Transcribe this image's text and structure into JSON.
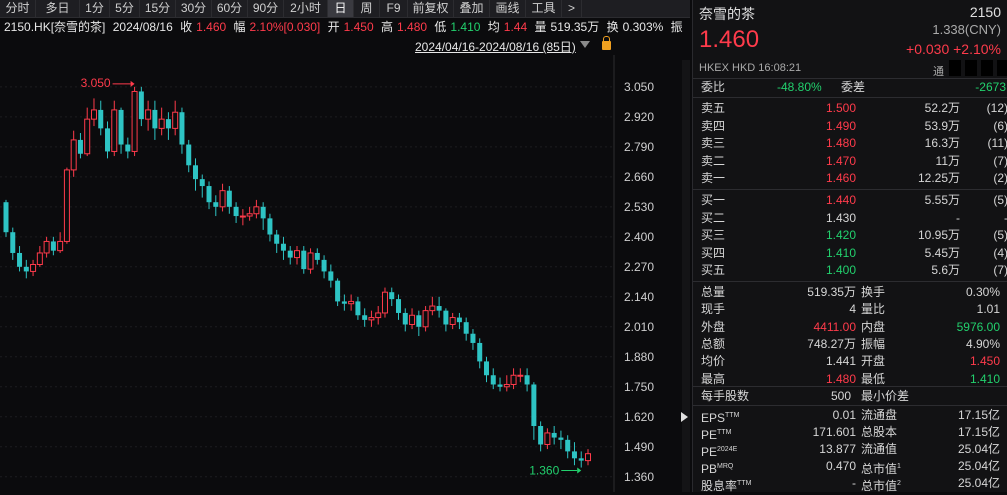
{
  "toolbar": {
    "items": [
      "分时",
      "多日",
      "1分",
      "5分",
      "15分",
      "30分",
      "60分",
      "90分",
      "2小时",
      "日",
      "周",
      "F9",
      "前复权",
      "叠加",
      "画线",
      "工具",
      ">"
    ],
    "active": "日"
  },
  "info": {
    "code": "2150.HK[奈雪的茶]",
    "date": "2024/08/16",
    "close_label": "收",
    "close": "1.460",
    "amp_label": "幅",
    "amp": "2.10%[0.030]",
    "open_label": "开",
    "open": "1.450",
    "high_label": "高",
    "high": "1.480",
    "low_label": "低",
    "low": "1.410",
    "avg_label": "均",
    "avg": "1.44",
    "vol_label": "量",
    "vol": "519.35万",
    "turn_label": "换",
    "turn": "0.303%",
    "tail": "振"
  },
  "daterange": "2024/04/16-2024/08/16 (85日)",
  "chart_data": {
    "type": "candlestick",
    "ymin": 1.32,
    "ymax": 3.11,
    "yticks": [
      "3.050",
      "2.920",
      "2.790",
      "2.660",
      "2.530",
      "2.400",
      "2.270",
      "2.140",
      "2.010",
      "1.880",
      "1.750",
      "1.620",
      "1.490",
      "1.360"
    ],
    "max_label": "3.050",
    "min_label": "1.360",
    "candles": [
      [
        2.55,
        2.42,
        2.56,
        2.4
      ],
      [
        2.42,
        2.33,
        2.44,
        2.3
      ],
      [
        2.33,
        2.27,
        2.36,
        2.25
      ],
      [
        2.27,
        2.25,
        2.3,
        2.22
      ],
      [
        2.25,
        2.28,
        2.3,
        2.23
      ],
      [
        2.28,
        2.33,
        2.36,
        2.27
      ],
      [
        2.33,
        2.38,
        2.4,
        2.31
      ],
      [
        2.38,
        2.34,
        2.4,
        2.32
      ],
      [
        2.34,
        2.38,
        2.42,
        2.33
      ],
      [
        2.38,
        2.69,
        2.7,
        2.37
      ],
      [
        2.69,
        2.82,
        2.86,
        2.66
      ],
      [
        2.82,
        2.76,
        2.85,
        2.74
      ],
      [
        2.76,
        2.91,
        2.96,
        2.75
      ],
      [
        2.91,
        2.95,
        3.0,
        2.88
      ],
      [
        2.95,
        2.87,
        2.99,
        2.84
      ],
      [
        2.87,
        2.77,
        2.9,
        2.74
      ],
      [
        2.77,
        2.95,
        2.99,
        2.75
      ],
      [
        2.95,
        2.8,
        2.96,
        2.76
      ],
      [
        2.8,
        2.77,
        2.83,
        2.74
      ],
      [
        2.77,
        3.03,
        3.05,
        2.75
      ],
      [
        3.03,
        2.91,
        3.05,
        2.88
      ],
      [
        2.91,
        2.95,
        2.99,
        2.86
      ],
      [
        2.95,
        2.87,
        2.99,
        2.82
      ],
      [
        2.87,
        2.91,
        2.96,
        2.84
      ],
      [
        2.91,
        2.87,
        2.94,
        2.82
      ],
      [
        2.87,
        2.94,
        2.99,
        2.84
      ],
      [
        2.94,
        2.8,
        2.96,
        2.76
      ],
      [
        2.8,
        2.71,
        2.82,
        2.68
      ],
      [
        2.71,
        2.65,
        2.74,
        2.6
      ],
      [
        2.65,
        2.62,
        2.67,
        2.57
      ],
      [
        2.62,
        2.55,
        2.64,
        2.52
      ],
      [
        2.55,
        2.53,
        2.58,
        2.49
      ],
      [
        2.53,
        2.6,
        2.63,
        2.51
      ],
      [
        2.6,
        2.53,
        2.62,
        2.5
      ],
      [
        2.53,
        2.49,
        2.55,
        2.46
      ],
      [
        2.49,
        2.49,
        2.52,
        2.45
      ],
      [
        2.49,
        2.5,
        2.53,
        2.47
      ],
      [
        2.5,
        2.53,
        2.56,
        2.48
      ],
      [
        2.53,
        2.48,
        2.55,
        2.43
      ],
      [
        2.48,
        2.41,
        2.5,
        2.38
      ],
      [
        2.41,
        2.37,
        2.43,
        2.33
      ],
      [
        2.37,
        2.34,
        2.4,
        2.3
      ],
      [
        2.34,
        2.31,
        2.36,
        2.28
      ],
      [
        2.31,
        2.34,
        2.36,
        2.28
      ],
      [
        2.34,
        2.26,
        2.36,
        2.24
      ],
      [
        2.26,
        2.33,
        2.35,
        2.24
      ],
      [
        2.33,
        2.3,
        2.35,
        2.28
      ],
      [
        2.3,
        2.25,
        2.32,
        2.22
      ],
      [
        2.25,
        2.21,
        2.28,
        2.18
      ],
      [
        2.21,
        2.12,
        2.22,
        2.1
      ],
      [
        2.12,
        2.11,
        2.15,
        2.08
      ],
      [
        2.11,
        2.12,
        2.15,
        2.08
      ],
      [
        2.12,
        2.06,
        2.14,
        2.04
      ],
      [
        2.06,
        2.04,
        2.09,
        2.01
      ],
      [
        2.04,
        2.05,
        2.08,
        2.01
      ],
      [
        2.05,
        2.07,
        2.1,
        2.02
      ],
      [
        2.07,
        2.16,
        2.18,
        2.05
      ],
      [
        2.16,
        2.13,
        2.18,
        2.1
      ],
      [
        2.13,
        2.07,
        2.15,
        2.04
      ],
      [
        2.07,
        2.02,
        2.09,
        1.99
      ],
      [
        2.02,
        2.06,
        2.09,
        2.0
      ],
      [
        2.06,
        2.01,
        2.08,
        1.97
      ],
      [
        2.01,
        2.08,
        2.1,
        1.99
      ],
      [
        2.08,
        2.1,
        2.14,
        2.06
      ],
      [
        2.1,
        2.08,
        2.14,
        2.05
      ],
      [
        2.08,
        2.02,
        2.09,
        1.99
      ],
      [
        2.02,
        2.05,
        2.07,
        2.0
      ],
      [
        2.05,
        2.03,
        2.07,
        2.0
      ],
      [
        2.03,
        1.98,
        2.05,
        1.95
      ],
      [
        1.98,
        1.94,
        2.0,
        1.91
      ],
      [
        1.94,
        1.86,
        1.96,
        1.83
      ],
      [
        1.86,
        1.8,
        1.88,
        1.77
      ],
      [
        1.8,
        1.76,
        1.83,
        1.74
      ],
      [
        1.76,
        1.75,
        1.79,
        1.73
      ],
      [
        1.75,
        1.76,
        1.8,
        1.73
      ],
      [
        1.76,
        1.8,
        1.83,
        1.74
      ],
      [
        1.8,
        1.8,
        1.83,
        1.77
      ],
      [
        1.8,
        1.76,
        1.83,
        1.73
      ],
      [
        1.76,
        1.58,
        1.77,
        1.52
      ],
      [
        1.58,
        1.5,
        1.6,
        1.47
      ],
      [
        1.5,
        1.55,
        1.57,
        1.48
      ],
      [
        1.55,
        1.53,
        1.58,
        1.5
      ],
      [
        1.53,
        1.52,
        1.56,
        1.48
      ],
      [
        1.52,
        1.47,
        1.54,
        1.44
      ],
      [
        1.47,
        1.44,
        1.51,
        1.41
      ],
      [
        1.44,
        1.43,
        1.47,
        1.4
      ],
      [
        1.43,
        1.46,
        1.48,
        1.41
      ]
    ]
  },
  "quote": {
    "name": "奈雪的茶",
    "code": "2150",
    "sub": "1.338(CNY)",
    "price": "1.460",
    "change": "+0.030 +2.10%",
    "market": "HKEX  HKD  16:08:21",
    "tong": "通"
  },
  "webi": {
    "label": "委比",
    "value": "-48.80%",
    "diff_label": "委差",
    "diff": "-2673"
  },
  "asks": [
    {
      "label": "卖五",
      "price": "1.500",
      "vol": "52.2万",
      "n": "(12)"
    },
    {
      "label": "卖四",
      "price": "1.490",
      "vol": "53.9万",
      "n": "(6)"
    },
    {
      "label": "卖三",
      "price": "1.480",
      "vol": "16.3万",
      "n": "(11)"
    },
    {
      "label": "卖二",
      "price": "1.470",
      "vol": "11万",
      "n": "(7)"
    },
    {
      "label": "卖一",
      "price": "1.460",
      "vol": "12.25万",
      "n": "(2)"
    }
  ],
  "bids": [
    {
      "label": "买一",
      "price": "1.440",
      "vol": "5.55万",
      "n": "(5)"
    },
    {
      "label": "买二",
      "price": "1.430",
      "vol": "-",
      "n": "-"
    },
    {
      "label": "买三",
      "price": "1.420",
      "vol": "10.95万",
      "n": "(5)"
    },
    {
      "label": "买四",
      "price": "1.410",
      "vol": "5.45万",
      "n": "(4)"
    },
    {
      "label": "买五",
      "price": "1.400",
      "vol": "5.6万",
      "n": "(7)"
    }
  ],
  "stats": [
    {
      "l1": "总量",
      "v1": "519.35万",
      "l2": "换手",
      "v2": "0.30%"
    },
    {
      "l1": "现手",
      "v1": "4",
      "l2": "量比",
      "v2": "1.01"
    },
    {
      "l1": "外盘",
      "v1": "4411.00",
      "l2": "内盘",
      "v2": "5976.00"
    },
    {
      "l1": "总额",
      "v1": "748.27万",
      "l2": "振幅",
      "v2": "4.90%"
    },
    {
      "l1": "均价",
      "v1": "1.441",
      "l2": "开盘",
      "v2": "1.450"
    },
    {
      "l1": "最高",
      "v1": "1.480",
      "l2": "最低",
      "v2": "1.410"
    }
  ],
  "fund": {
    "lot_label": "每手股数",
    "lot": "500",
    "tick_label": "最小价差"
  },
  "fundrows": [
    {
      "l1": "EPS",
      "s1": "TTM",
      "v1": "0.01",
      "l2": "流通盘",
      "s2": "",
      "v2": "17.15亿"
    },
    {
      "l1": "PE",
      "s1": "TTM",
      "v1": "171.601",
      "l2": "总股本",
      "s2": "",
      "v2": "17.15亿"
    },
    {
      "l1": "PE",
      "s1": "2024E",
      "v1": "13.877",
      "l2": "流通值",
      "s2": "",
      "v2": "25.04亿"
    },
    {
      "l1": "PB",
      "s1": "MRQ",
      "v1": "0.470",
      "l2": "总市值",
      "s2": "1",
      "v2": "25.04亿"
    },
    {
      "l1": "股息率",
      "s1": "TTM",
      "v1": "-",
      "l2": "总市值",
      "s2": "2",
      "v2": "25.04亿"
    }
  ],
  "colors": {
    "up": "#ff3b4b",
    "down": "#2ec4c4",
    "green": "#22d06d"
  }
}
